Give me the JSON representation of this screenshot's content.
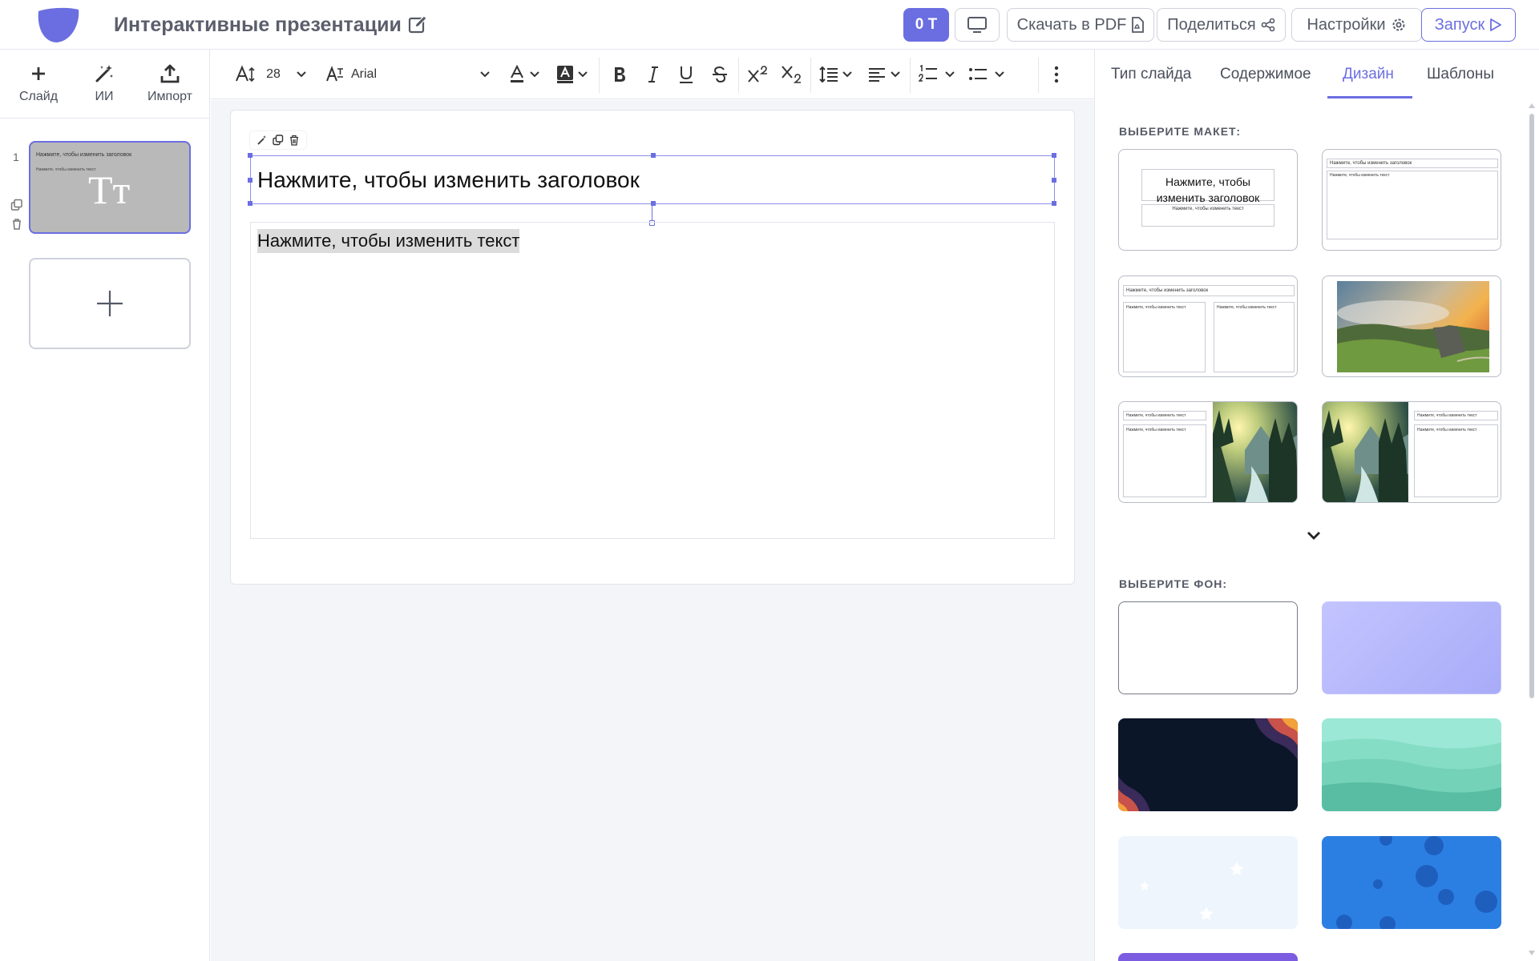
{
  "app": {
    "title": "Интерактивные презентации",
    "accent_color": "#6b6ee0"
  },
  "topbar": {
    "user_initials": "0 T",
    "present_icon": "monitor-icon",
    "pdf_label": "Скачать в PDF",
    "share_label": "Поделиться",
    "settings_label": "Настройки",
    "launch_label": "Запуск"
  },
  "sidebar": {
    "tools": [
      {
        "label": "Слайд",
        "icon": "plus-icon"
      },
      {
        "label": "ИИ",
        "icon": "magic-wand-icon"
      },
      {
        "label": "Импорт",
        "icon": "upload-icon"
      }
    ],
    "slides": [
      {
        "number": "1",
        "title": "Нажмите, чтобы изменить заголовок",
        "text": "Нажмите, чтобы изменить текст",
        "glyph": "Tт"
      }
    ]
  },
  "format_toolbar": {
    "font_size": "28",
    "font_name": "Arial"
  },
  "slide": {
    "title": "Нажмите, чтобы изменить заголовок",
    "body": "Нажмите, чтобы изменить текст"
  },
  "panel": {
    "tabs": [
      "Тип слайда",
      "Содержимое",
      "Дизайн",
      "Шаблоны"
    ],
    "active_tab": "Дизайн",
    "layout_label": "ВЫБЕРИТЕ МАКЕТ:",
    "background_label": "ВЫБЕРИТЕ ФОН:",
    "layout_title_center": "Нажмите, чтобы изменить заголовок",
    "layout_text_small": "Нажмите, чтобы изменить текст",
    "layout_title_small": "Нажмите, чтобы изменить заголовок",
    "backgrounds": [
      {
        "name": "white",
        "color": "#ffffff"
      },
      {
        "name": "lavender",
        "color": "#b3b5fb"
      },
      {
        "name": "dark-waves",
        "color": "#0b1628"
      },
      {
        "name": "mint-waves",
        "color": "#7ddcc4"
      },
      {
        "name": "pale-stars",
        "color": "#eef5fd"
      },
      {
        "name": "blue-bubbles",
        "color": "#2c7fe2"
      }
    ]
  }
}
